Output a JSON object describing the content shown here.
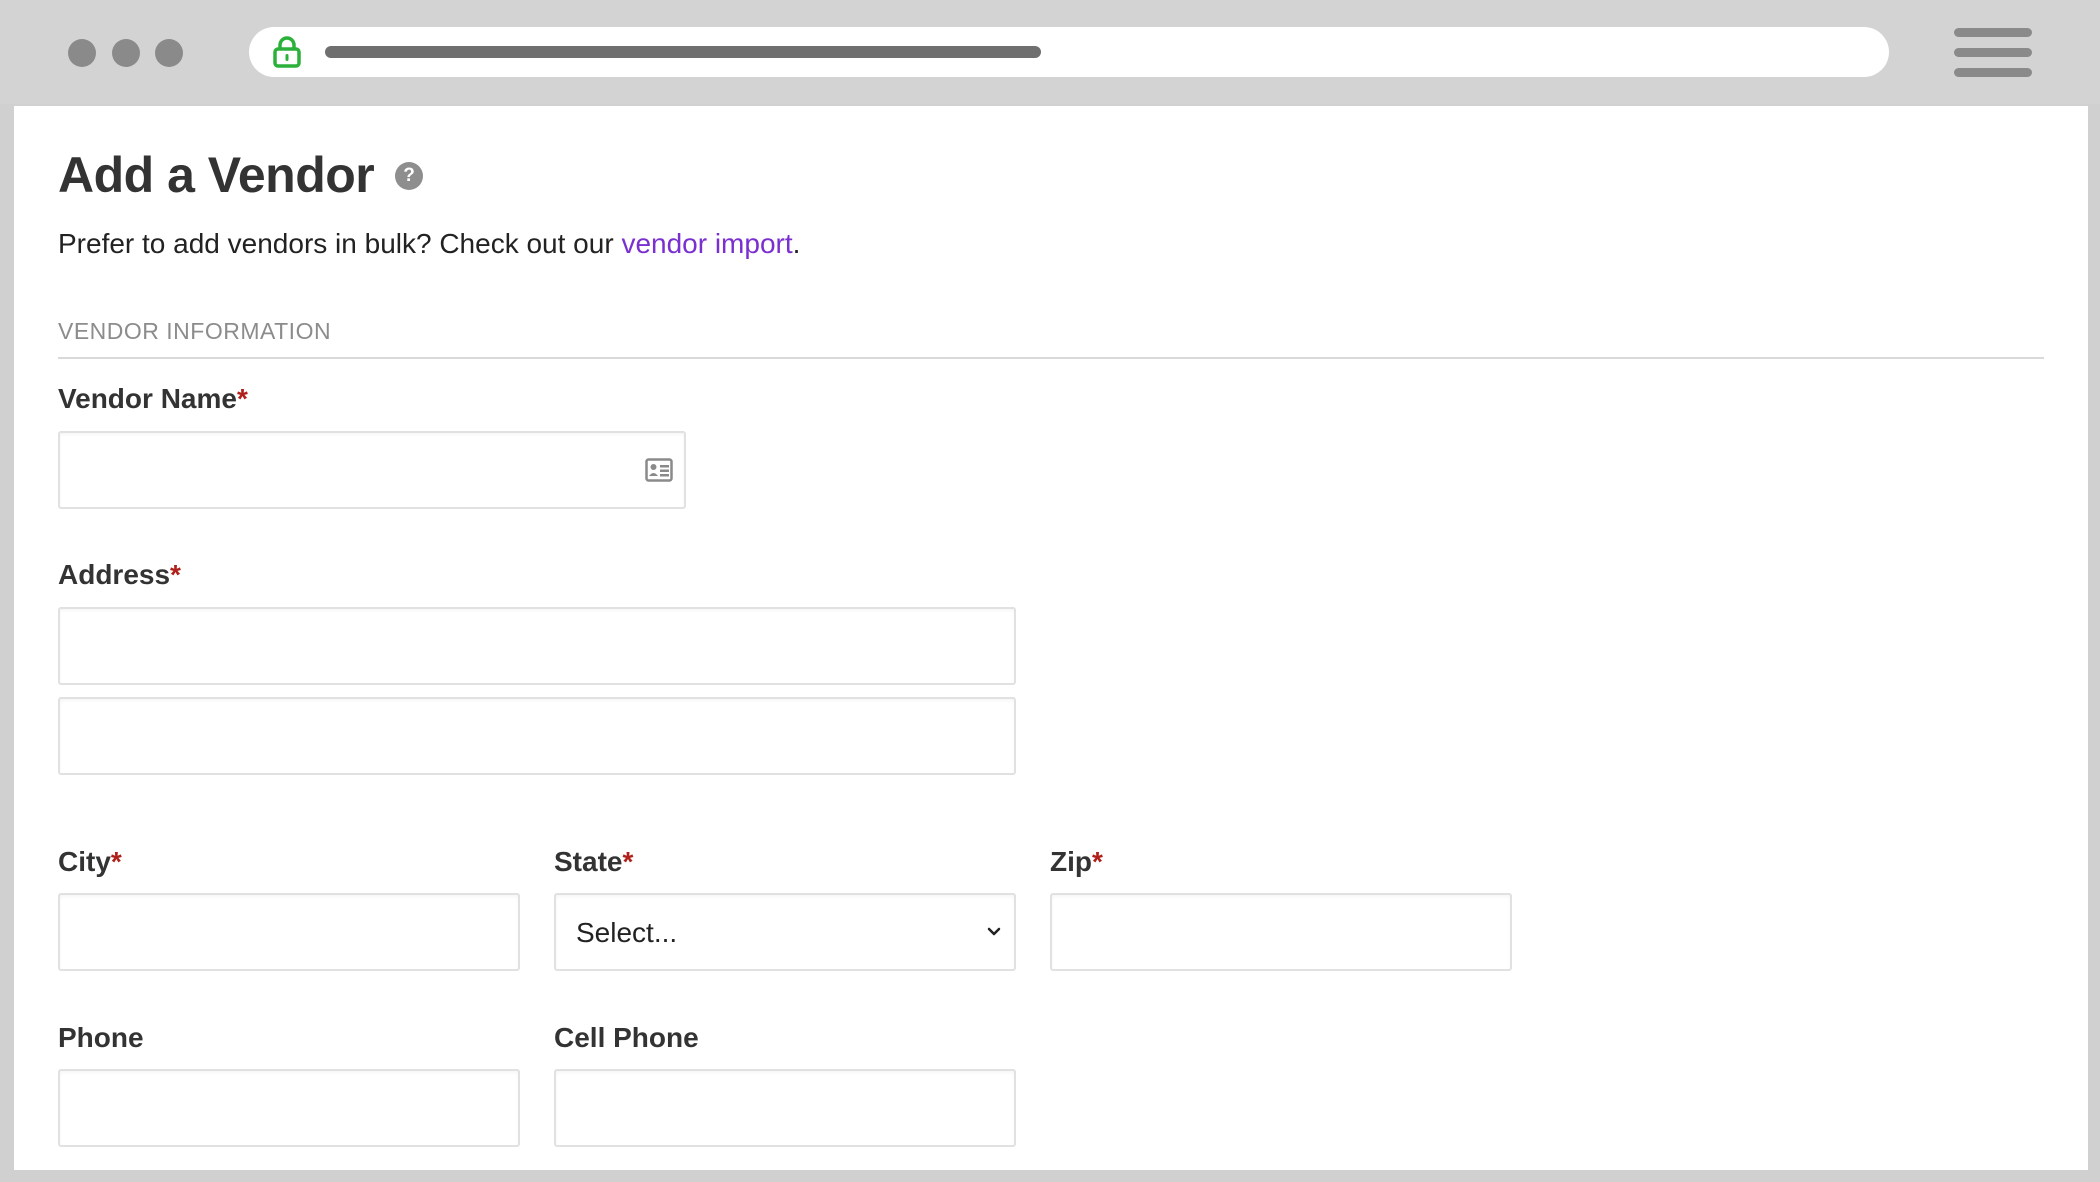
{
  "page": {
    "title": "Add a Vendor",
    "help_icon_glyph": "?",
    "intro_text": "Prefer to add vendors in bulk? Check out our ",
    "intro_link": "vendor import",
    "intro_end": ".",
    "section_heading": "VENDOR INFORMATION"
  },
  "form": {
    "required_marker": "*",
    "vendor_name": {
      "label": "Vendor Name",
      "value": "",
      "icon": "contact-card-icon"
    },
    "address": {
      "label": "Address",
      "line1": "",
      "line2": ""
    },
    "city": {
      "label": "City",
      "value": ""
    },
    "state": {
      "label": "State",
      "selected": "Select..."
    },
    "zip": {
      "label": "Zip",
      "value": ""
    },
    "phone": {
      "label": "Phone",
      "value": ""
    },
    "cell_phone": {
      "label": "Cell Phone",
      "value": ""
    }
  },
  "colors": {
    "link": "#7a2fd0",
    "required": "#b0201a",
    "lock": "#2bb13a"
  }
}
